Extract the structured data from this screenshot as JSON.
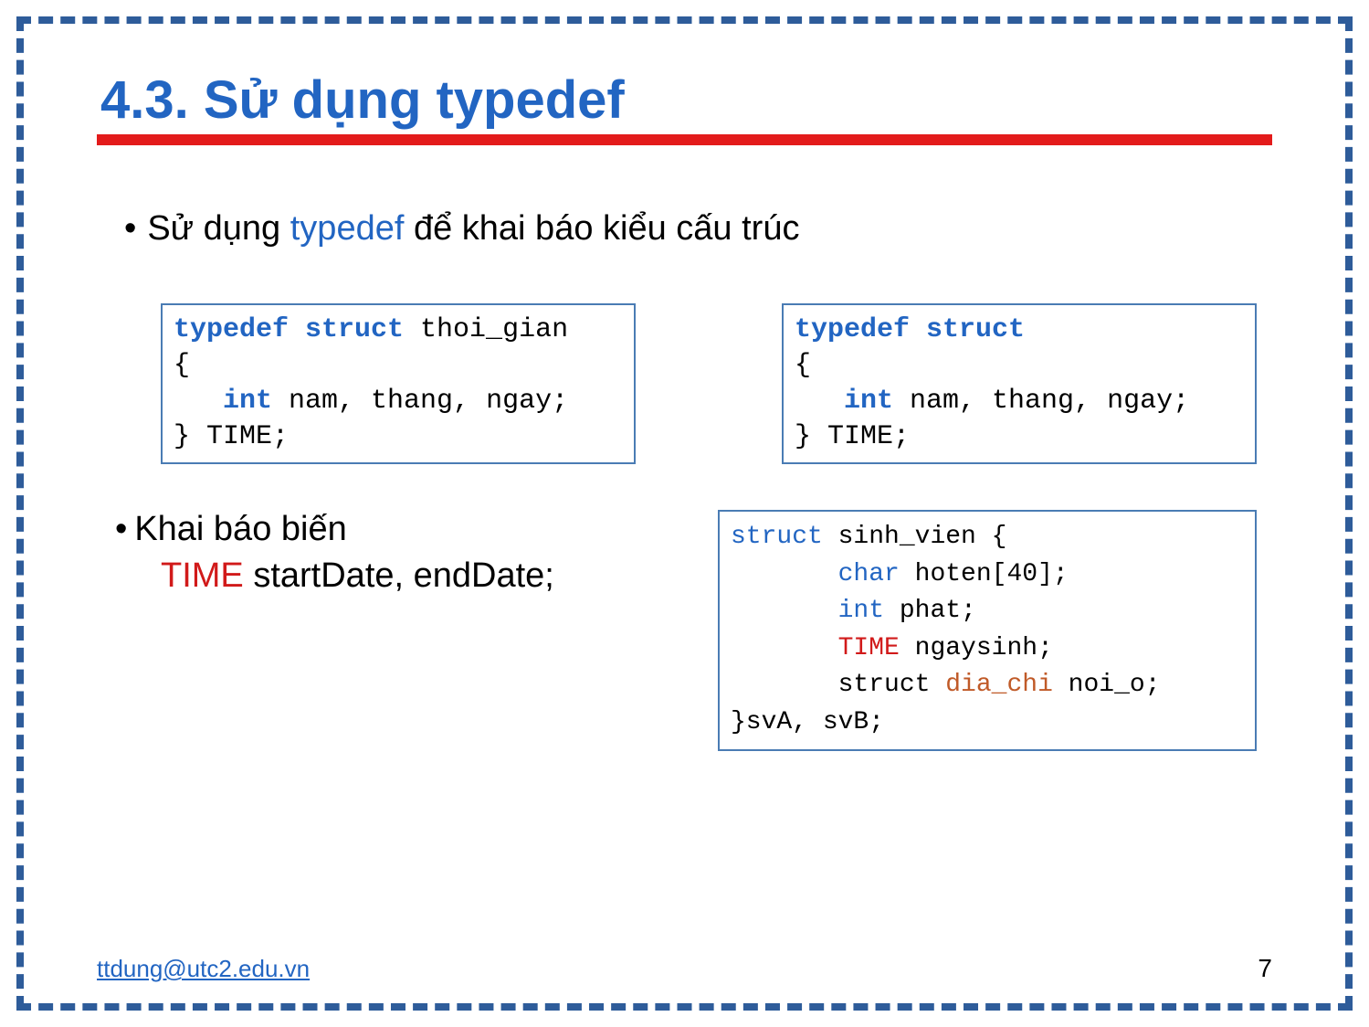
{
  "title": "4.3. Sử dụng typedef",
  "bullet1_pre": "Sử dụng ",
  "bullet1_kw": "typedef",
  "bullet1_post": " để khai báo kiểu cấu trúc",
  "code1": {
    "l1a": "typedef struct",
    "l1b": " thoi_gian",
    "l2": "{",
    "l3a": "   ",
    "l3b": "int",
    "l3c": " nam, thang, ngay;",
    "l4": "} TIME;"
  },
  "code2": {
    "l1": "typedef struct",
    "l2": "{",
    "l3a": "   ",
    "l3b": "int",
    "l3c": " nam, thang, ngay;",
    "l4": "} TIME;"
  },
  "bullet2": "Khai báo biến",
  "decl_kw": "TIME",
  "decl_rest": " startDate, endDate;",
  "code3": {
    "l1a": "struct",
    "l1b": " sinh_vien {",
    "l2a": "       ",
    "l2b": "char",
    "l2c": " hoten[40];",
    "l3a": "       ",
    "l3b": "int",
    "l3c": " phat;",
    "l4a": "       ",
    "l4b": "TIME",
    "l4c": " ngaysinh;",
    "l5a": "       struct ",
    "l5b": "dia_chi",
    "l5c": " noi_o;",
    "l6": "}svA, svB;"
  },
  "footer_email": "ttdung@utc2.edu.vn",
  "page_number": "7"
}
